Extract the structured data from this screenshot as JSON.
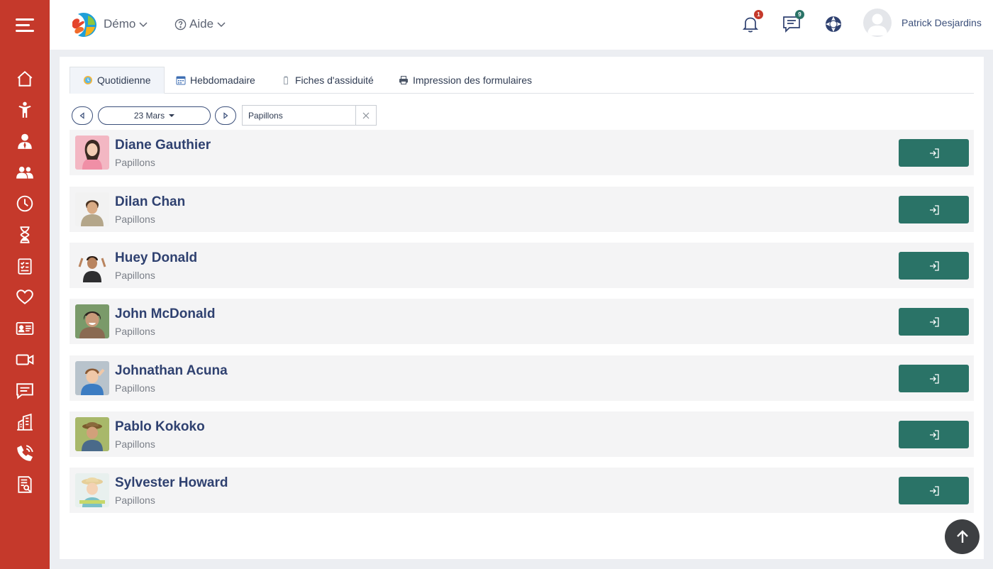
{
  "header": {
    "org_label": "Démo",
    "help_label": "Aide",
    "notifications_count": "1",
    "messages_count": "9",
    "user_name": "Patrick Desjardins"
  },
  "sidebar": {
    "icons": [
      "home-icon",
      "child-icon",
      "staff-icon",
      "groups-icon",
      "clock-icon",
      "hourglass-icon",
      "checklist-icon",
      "heart-icon",
      "id-card-icon",
      "video-icon",
      "messages-icon",
      "building-icon",
      "phone-icon",
      "report-icon"
    ]
  },
  "tabs": [
    {
      "label": "Quotidienne",
      "active": true
    },
    {
      "label": "Hebdomadaire",
      "active": false
    },
    {
      "label": "Fiches d'assiduité",
      "active": false
    },
    {
      "label": "Impression des formulaires",
      "active": false
    }
  ],
  "controls": {
    "date_label": "23 Mars",
    "filter_value": "Papillons"
  },
  "children": [
    {
      "name": "Diane Gauthier",
      "group": "Papillons"
    },
    {
      "name": "Dilan Chan",
      "group": "Papillons"
    },
    {
      "name": "Huey Donald",
      "group": "Papillons"
    },
    {
      "name": "John McDonald",
      "group": "Papillons"
    },
    {
      "name": "Johnathan Acuna",
      "group": "Papillons"
    },
    {
      "name": "Pablo Kokoko",
      "group": "Papillons"
    },
    {
      "name": "Sylvester Howard",
      "group": "Papillons"
    }
  ],
  "colors": {
    "sidebar": "#c5392b",
    "checkin_button": "#2a7367",
    "name_text": "#2f4170",
    "notification_badge": "#c5392b",
    "message_badge": "#2a7367"
  }
}
